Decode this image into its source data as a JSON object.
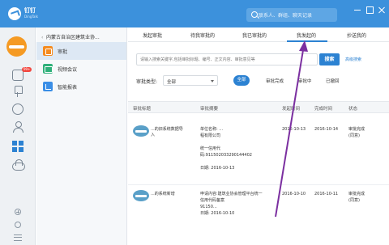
{
  "titlebar": {
    "app_name": "钉钉",
    "app_sub": "DingTalk",
    "search_placeholder": "联系人、群组、聊天记录"
  },
  "iconbar": {
    "badge": "99+"
  },
  "sidebar": {
    "breadcrumb": "内蒙古自治区建筑业协...",
    "items": [
      {
        "label": "审批"
      },
      {
        "label": "视频会议"
      },
      {
        "label": "智能报表"
      }
    ]
  },
  "tabs": [
    {
      "label": "发起审批"
    },
    {
      "label": "待我审批的"
    },
    {
      "label": "我已审批的"
    },
    {
      "label": "我发起的"
    },
    {
      "label": "抄送我的"
    }
  ],
  "filter": {
    "placeholder": "请输入搜索关键字,包括审批标题、编号、正文内容、审批意见等",
    "search_button": "搜索",
    "advanced_search": "高级搜索",
    "type_label": "审批类型:",
    "type_value": "全部",
    "status_options": [
      "全部",
      "审批完成",
      "审批中",
      "已撤回"
    ]
  },
  "table": {
    "headers": [
      "审批标题",
      "审批摘要",
      "发起时间",
      "完成时间",
      "状态"
    ],
    "rows": [
      {
        "title": "...的旧系统数据导入",
        "summary_1": "单位名称: ...",
        "summary_2": "程有限公司",
        "summary_3": "统一信用代",
        "summary_4": "码:911502033290144402",
        "summary_5": "日期: 2016-10-13",
        "start": "2016-10-13",
        "end": "2016-10-14",
        "status_1": "审批完成",
        "status_2": "(同意)"
      },
      {
        "title": "...的系统新增",
        "summary_1": "申请内容:建筑业协会管理平台统一",
        "summary_2": "信用代码备案",
        "summary_3": "91150...",
        "summary_4": "",
        "summary_5": "日期: 2016-10-10",
        "start": "2016-10-10",
        "end": "2016-10-11",
        "status_1": "审批完成",
        "status_2": "(同意)"
      }
    ]
  }
}
